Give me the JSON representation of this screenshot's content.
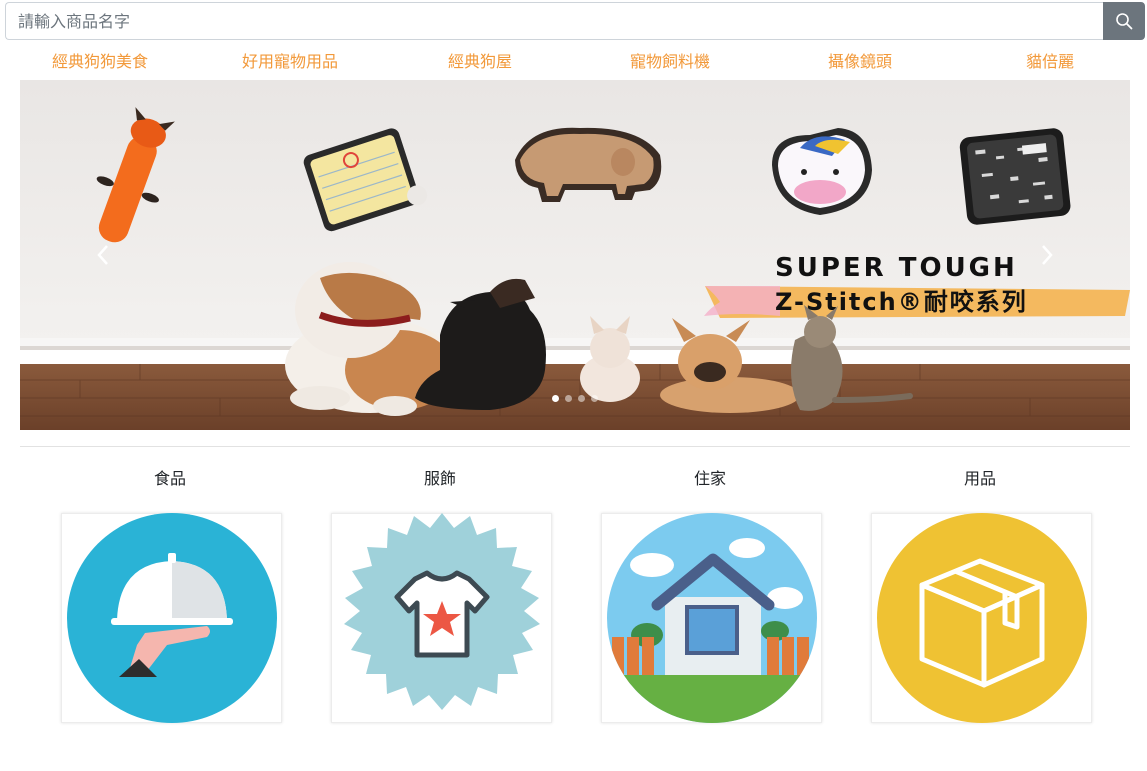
{
  "search": {
    "placeholder": "請輸入商品名字"
  },
  "nav": {
    "items": [
      {
        "label": "經典狗狗美食"
      },
      {
        "label": "好用寵物用品"
      },
      {
        "label": "經典狗屋"
      },
      {
        "label": "寵物飼料機"
      },
      {
        "label": "攝像鏡頭"
      },
      {
        "label": "貓倍麗"
      }
    ]
  },
  "banner": {
    "headline": "SUPER TOUGH",
    "subline": "Z-Stitch®耐咬系列",
    "active_slide": 1,
    "slide_count": 4
  },
  "categories": [
    {
      "label": "食品",
      "icon": "serving-cloche-icon",
      "bg": "#2ab3d6"
    },
    {
      "label": "服飾",
      "icon": "tshirt-star-icon",
      "bg": "#9fd1da"
    },
    {
      "label": "住家",
      "icon": "house-icon",
      "bg": "#7ccbef"
    },
    {
      "label": "用品",
      "icon": "package-box-icon",
      "bg": "#efc233"
    }
  ],
  "colors": {
    "nav_text": "#f2993a",
    "search_button": "#6c757d"
  }
}
